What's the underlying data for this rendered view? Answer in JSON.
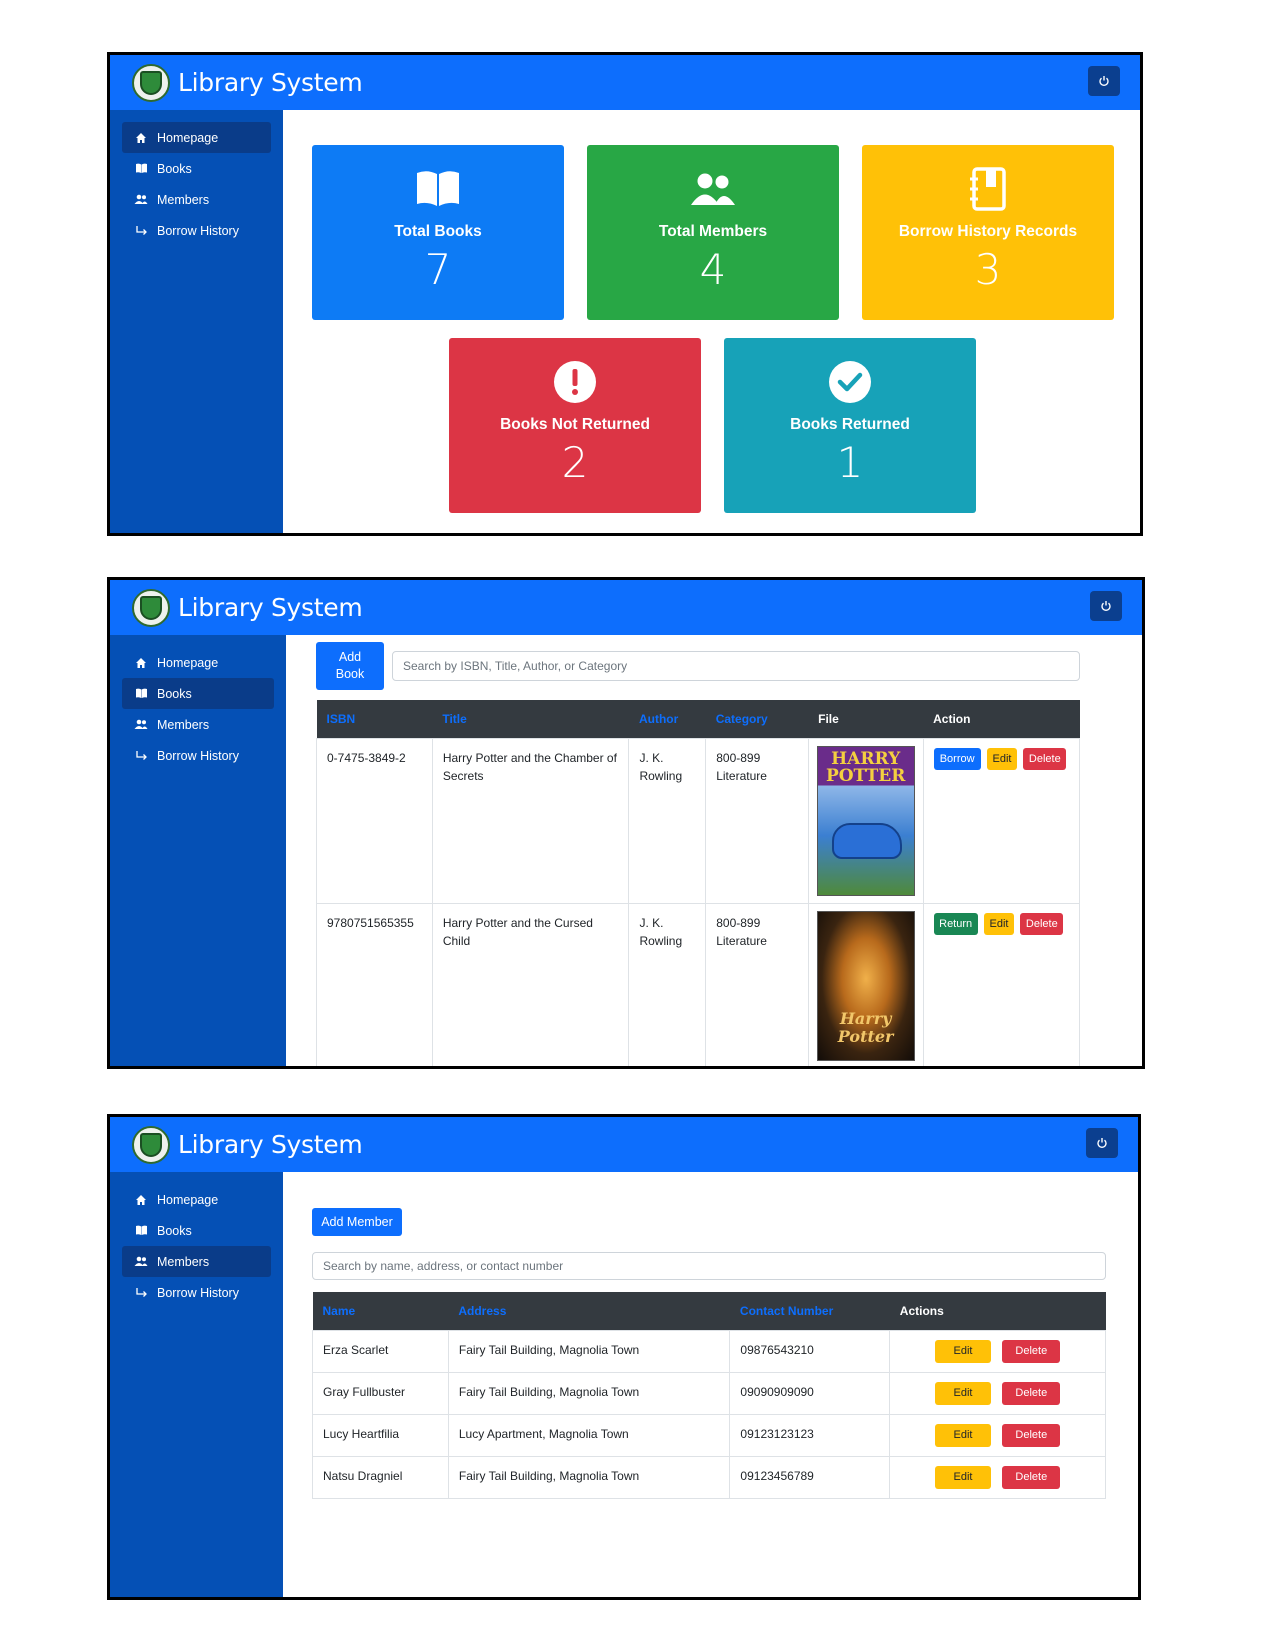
{
  "brand": "Library System",
  "nav": {
    "items": [
      {
        "label": "Homepage",
        "icon": "home-icon"
      },
      {
        "label": "Books",
        "icon": "book-icon"
      },
      {
        "label": "Members",
        "icon": "users-icon"
      },
      {
        "label": "Borrow History",
        "icon": "history-arrow-icon"
      }
    ]
  },
  "dashboard": {
    "cards": [
      {
        "title": "Total Books",
        "value": "7",
        "color": "#0d6efd",
        "icon": "open-book-icon"
      },
      {
        "title": "Total Members",
        "value": "4",
        "color": "#28a745",
        "icon": "users-icon"
      },
      {
        "title": "Borrow History Records",
        "value": "3",
        "color": "#ffc107",
        "icon": "address-book-icon"
      },
      {
        "title": "Books Not Returned",
        "value": "2",
        "color": "#dc3545",
        "icon": "exclamation-circle-icon"
      },
      {
        "title": "Books Returned",
        "value": "1",
        "color": "#17a2b8",
        "icon": "check-circle-icon"
      }
    ]
  },
  "books": {
    "add_label_line1": "Add",
    "add_label_line2": "Book",
    "search_placeholder": "Search by ISBN, Title, Author, or Category",
    "columns": [
      "ISBN",
      "Title",
      "Author",
      "Category",
      "File",
      "Action"
    ],
    "rows": [
      {
        "isbn": "0-7475-3849-2",
        "title": "Harry Potter and the Chamber of Secrets",
        "author": "J. K. Rowling",
        "category": "800-899 Literature",
        "primary_action": "Borrow"
      },
      {
        "isbn": "9780751565355",
        "title": "Harry Potter and the Cursed Child",
        "author": "J. K. Rowling",
        "category": "800-899 Literature",
        "primary_action": "Return"
      }
    ],
    "edit_label": "Edit",
    "delete_label": "Delete",
    "cover1_text": "HARRY POTTER",
    "cover2_text": "Harry Potter"
  },
  "members": {
    "add_label": "Add Member",
    "search_placeholder": "Search by name, address, or contact number",
    "columns": [
      "Name",
      "Address",
      "Contact Number",
      "Actions"
    ],
    "rows": [
      {
        "name": "Erza Scarlet",
        "address": "Fairy Tail Building, Magnolia Town",
        "contact": "09876543210"
      },
      {
        "name": "Gray Fullbuster",
        "address": "Fairy Tail Building, Magnolia Town",
        "contact": "09090909090"
      },
      {
        "name": "Lucy Heartfilia",
        "address": "Lucy Apartment, Magnolia Town",
        "contact": "09123123123"
      },
      {
        "name": "Natsu Dragniel",
        "address": "Fairy Tail Building, Magnolia Town",
        "contact": "09123456789"
      }
    ],
    "edit_label": "Edit",
    "delete_label": "Delete"
  }
}
